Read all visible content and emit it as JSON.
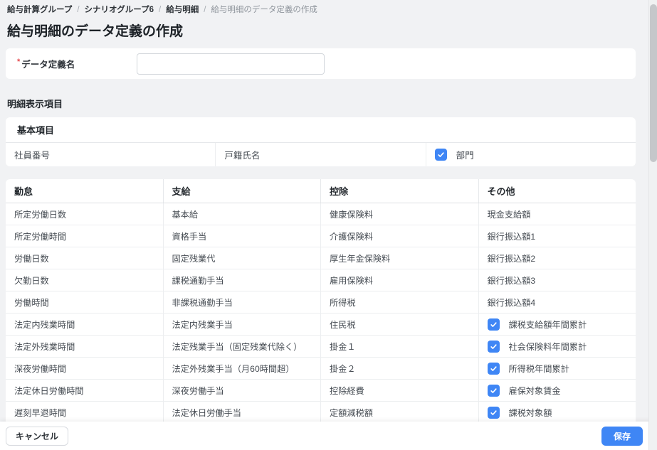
{
  "colors": {
    "accent": "#3f86f5",
    "required": "#e5484d"
  },
  "breadcrumb": {
    "separator": "/",
    "items": [
      {
        "label": "給与計算グループ"
      },
      {
        "label": "シナリオグループ6"
      },
      {
        "label": "給与明細"
      },
      {
        "label": "給与明細のデータ定義の作成"
      }
    ]
  },
  "page": {
    "title": "給与明細のデータ定義の作成"
  },
  "form": {
    "data_definition_name": {
      "required_mark": "*",
      "label": "データ定義名",
      "value": "",
      "placeholder": ""
    }
  },
  "detail_section": {
    "heading": "明細表示項目",
    "basic": {
      "heading": "基本項目",
      "items": [
        {
          "label": "社員番号",
          "checkbox": false
        },
        {
          "label": "戸籍氏名",
          "checkbox": false
        },
        {
          "label": "部門",
          "checkbox": true,
          "checked": true
        }
      ]
    }
  },
  "items_table": {
    "columns": [
      "勤怠",
      "支給",
      "控除",
      "その他"
    ],
    "rows": [
      {
        "cells": [
          {
            "label": "所定労働日数",
            "checkbox": false
          },
          {
            "label": "基本給",
            "checkbox": false
          },
          {
            "label": "健康保険料",
            "checkbox": false
          },
          {
            "label": "現金支給額",
            "checkbox": false
          }
        ]
      },
      {
        "cells": [
          {
            "label": "所定労働時間",
            "checkbox": false
          },
          {
            "label": "資格手当",
            "checkbox": false
          },
          {
            "label": "介護保険料",
            "checkbox": false
          },
          {
            "label": "銀行振込額1",
            "checkbox": false
          }
        ]
      },
      {
        "cells": [
          {
            "label": "労働日数",
            "checkbox": false
          },
          {
            "label": "固定残業代",
            "checkbox": false
          },
          {
            "label": "厚生年金保険料",
            "checkbox": false
          },
          {
            "label": "銀行振込額2",
            "checkbox": false
          }
        ]
      },
      {
        "cells": [
          {
            "label": "欠勤日数",
            "checkbox": false
          },
          {
            "label": "課税通勤手当",
            "checkbox": false
          },
          {
            "label": "雇用保険料",
            "checkbox": false
          },
          {
            "label": "銀行振込額3",
            "checkbox": false
          }
        ]
      },
      {
        "cells": [
          {
            "label": "労働時間",
            "checkbox": false
          },
          {
            "label": "非課税通勤手当",
            "checkbox": false
          },
          {
            "label": "所得税",
            "checkbox": false
          },
          {
            "label": "銀行振込額4",
            "checkbox": false
          }
        ]
      },
      {
        "cells": [
          {
            "label": "法定内残業時間",
            "checkbox": false
          },
          {
            "label": "法定内残業手当",
            "checkbox": false
          },
          {
            "label": "住民税",
            "checkbox": false
          },
          {
            "label": "課税支給額年間累計",
            "checkbox": true,
            "checked": true
          }
        ]
      },
      {
        "cells": [
          {
            "label": "法定外残業時間",
            "checkbox": false
          },
          {
            "label": "法定残業手当（固定残業代除く）",
            "checkbox": false
          },
          {
            "label": "掛金１",
            "checkbox": false
          },
          {
            "label": "社会保険料年間累計",
            "checkbox": true,
            "checked": true
          }
        ]
      },
      {
        "cells": [
          {
            "label": "深夜労働時間",
            "checkbox": false
          },
          {
            "label": "法定外残業手当（月60時間超）",
            "checkbox": false
          },
          {
            "label": "掛金２",
            "checkbox": false
          },
          {
            "label": "所得税年間累計",
            "checkbox": true,
            "checked": true
          }
        ]
      },
      {
        "cells": [
          {
            "label": "法定休日労働時間",
            "checkbox": false
          },
          {
            "label": "深夜労働手当",
            "checkbox": false
          },
          {
            "label": "控除経費",
            "checkbox": false
          },
          {
            "label": "雇保対象賃金",
            "checkbox": true,
            "checked": true
          }
        ]
      },
      {
        "cells": [
          {
            "label": "遅刻早退時間",
            "checkbox": false
          },
          {
            "label": "法定休日労働手当",
            "checkbox": false
          },
          {
            "label": "定額減税額",
            "checkbox": false
          },
          {
            "label": "課税対象額",
            "checkbox": true,
            "checked": true
          }
        ]
      }
    ]
  },
  "footer": {
    "cancel_label": "キャンセル",
    "save_label": "保存"
  }
}
